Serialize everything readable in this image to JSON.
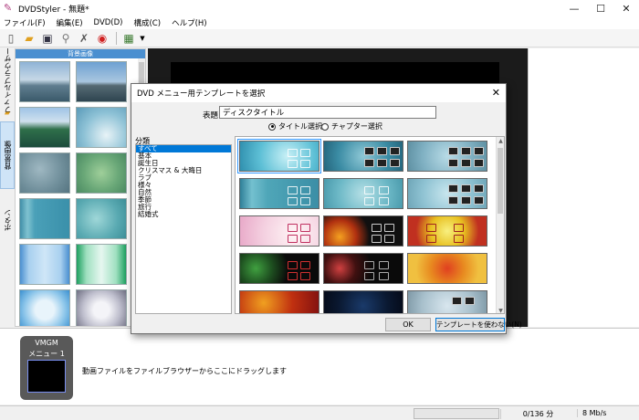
{
  "window": {
    "title": "DVDStyler - 無題*",
    "minimize": "—",
    "maximize": "☐",
    "close": "✕"
  },
  "menubar": [
    "ファイル(F)",
    "編集(E)",
    "DVD(D)",
    "構成(C)",
    "ヘルプ(H)"
  ],
  "left_tabs": [
    "ファイルブラウザー",
    "背景画像",
    "ボタン"
  ],
  "bg_panel": {
    "header": "背景画像"
  },
  "vmgm": {
    "label": "VMGM",
    "menu_label": "メニュー 1"
  },
  "drag_hint": "動画ファイルをファイルブラウザーからここにドラッグします",
  "status": {
    "size": "0/136 分",
    "rate": "8 Mb/s"
  },
  "dialog": {
    "title": "DVD メニュー用テンプレートを選択",
    "close": "✕",
    "title_label": "表題:",
    "title_value": "ディスクタイトル",
    "radio_title": "タイトル選択",
    "radio_chapter": "チャプター選択",
    "radio_selected": "title",
    "category_label": "分類",
    "categories": [
      "すべて",
      "基本",
      "誕生日",
      "クリスマス & 大晦日",
      "ラブ",
      "様々",
      "自然",
      "季節",
      "旅行",
      "結婚式"
    ],
    "selected_category": "すべて",
    "ok": "OK",
    "no_template": "テンプレートを使わない(N)"
  },
  "colors": {
    "accent": "#0078d7",
    "bg_header": "#4a8fd0",
    "vmgm_box": "#595959",
    "canvas": "#000000"
  }
}
